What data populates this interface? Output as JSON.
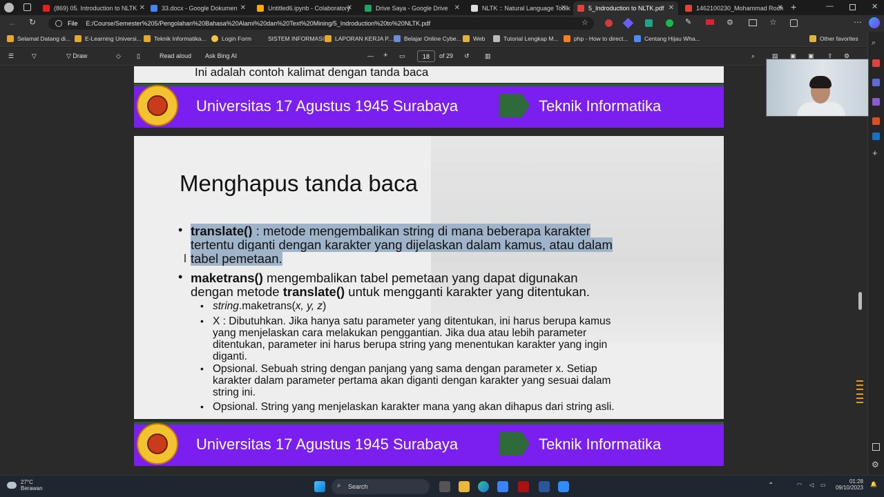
{
  "tabs": [
    {
      "label": "(869) 05. Introduction to NLTK",
      "color": "#e62117"
    },
    {
      "label": "33.docx - Google Dokumen",
      "color": "#4285f4"
    },
    {
      "label": "Untitled6.ipynb - Colaboratory",
      "color": "#f9ab00"
    },
    {
      "label": "Drive Saya - Google Drive",
      "color": "#1fa463"
    },
    {
      "label": "NLTK :: Natural Language Toolki",
      "color": "#dddddd"
    },
    {
      "label": "5_Indroduction to NLTK.pdf",
      "color": "#e0433a"
    },
    {
      "label": "1462100230_Mohammad Roch",
      "color": "#e0433a"
    }
  ],
  "address": {
    "file_label": "File",
    "url": "E:/Course/Semester%205/Pengolahan%20Bahasa%20Alami%20dan%20Text%20Mining/5_Indroduction%20to%20NLTK.pdf"
  },
  "bookmarks": [
    {
      "label": "Selamat Datang di..."
    },
    {
      "label": "E-Learning Universi..."
    },
    {
      "label": "Teknik Informatika..."
    },
    {
      "label": "Login Form"
    },
    {
      "label": "SISTEM INFORMASI"
    },
    {
      "label": "LAPORAN KERJA P..."
    },
    {
      "label": "Belajar Online Cybe..."
    },
    {
      "label": "Web"
    },
    {
      "label": "Tutorial Lengkap M..."
    },
    {
      "label": "php - How to direct..."
    },
    {
      "label": "Centang Hijau Wha..."
    },
    {
      "label": "Other favorites"
    }
  ],
  "pdf_toolbar": {
    "draw": "Draw",
    "read_aloud": "Read aloud",
    "ask_bing": "Ask Bing AI",
    "minus": "—",
    "plus": "+",
    "page_current": "18",
    "page_total": "of 29"
  },
  "document": {
    "top_line": "Ini adalah contoh kalimat dengan tanda baca",
    "banner_university": "Universitas 17 Agustus 1945 Surabaya",
    "banner_faculty": "Teknik Informatika",
    "slide_title": "Menghapus tanda baca",
    "bullet1_bold": "translate()",
    "bullet1_line1_rest": " : metode mengembalikan string di mana beberapa karakter",
    "bullet1_line2": "tertentu diganti dengan karakter yang dijelaskan dalam kamus, atau dalam",
    "bullet1_line3": "tabel pemetaan.",
    "bullet2_bold": "maketrans()",
    "bullet2_line1_rest": " mengembalikan tabel pemetaan yang dapat digunakan",
    "bullet2_line2_a": "dengan metode ",
    "bullet2_line2_bold": "translate()",
    "bullet2_line2_b": " untuk mengganti karakter yang ditentukan.",
    "sub1_italic": "string",
    "sub1_rest": ".maketrans(",
    "sub1_params": "x, y, z",
    "sub1_close": ")",
    "sub2_l1": "X : Dibutuhkan. Jika hanya satu parameter yang ditentukan, ini harus berupa kamus",
    "sub2_l2": "yang menjelaskan cara melakukan penggantian. Jika dua atau lebih parameter",
    "sub2_l3": "ditentukan, parameter ini harus berupa string yang menentukan karakter yang ingin",
    "sub2_l4": "diganti.",
    "sub3_l1": "Opsional. Sebuah string dengan panjang yang sama dengan parameter x. Setiap",
    "sub3_l2": "karakter dalam parameter pertama akan diganti dengan karakter yang sesuai dalam",
    "sub3_l3": "string ini.",
    "sub4_l1": "Opsional. String yang menjelaskan karakter mana yang akan dihapus dari string asli."
  },
  "taskbar": {
    "weather_temp": "27°C",
    "weather_desc": "Berawan",
    "search": "Search",
    "time": "01:28",
    "date": "09/10/2023"
  }
}
